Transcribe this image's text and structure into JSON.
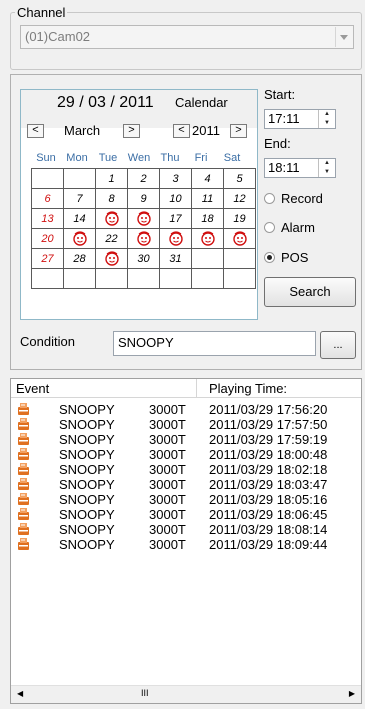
{
  "channel": {
    "legend": "Channel",
    "selected": "(01)Cam02"
  },
  "calendar": {
    "date": "29 / 03 / 2011",
    "title": "Calendar",
    "month_prev": "<",
    "month": "March",
    "month_next": ">",
    "year_prev": "<",
    "year": "2011",
    "year_next": ">",
    "weekdays": [
      "Sun",
      "Mon",
      "Tue",
      "Wen",
      "Thu",
      "Fri",
      "Sat"
    ],
    "weeks": [
      [
        "",
        "",
        "1",
        "2",
        "3",
        "4",
        "5"
      ],
      [
        "6",
        "7",
        "8",
        "9",
        "10",
        "11",
        "12"
      ],
      [
        "13",
        "14",
        "15",
        "16",
        "17",
        "18",
        "19"
      ],
      [
        "20",
        "21",
        "22",
        "23",
        "24",
        "25",
        "26"
      ],
      [
        "27",
        "28",
        "29",
        "30",
        "31",
        "",
        ""
      ],
      [
        "",
        "",
        "",
        "",
        "",
        "",
        ""
      ]
    ],
    "face_days": [
      "15",
      "16",
      "21",
      "23",
      "24",
      "25",
      "26",
      "29"
    ],
    "red_days": [
      "6",
      "13",
      "20",
      "27"
    ]
  },
  "time": {
    "start_label": "Start:",
    "start_value": "17:11",
    "end_label": "End:",
    "end_value": "18:11"
  },
  "filters": {
    "options": [
      "Record",
      "Alarm",
      "POS"
    ],
    "selected": "POS"
  },
  "search_label": "Search",
  "condition": {
    "label": "Condition",
    "value": "SNOOPY",
    "browse_label": "..."
  },
  "events": {
    "columns": [
      "Event",
      "Playing Time:"
    ],
    "rows": [
      {
        "name": "SNOOPY",
        "code": "3000T",
        "time": "2011/03/29 17:56:20"
      },
      {
        "name": "SNOOPY",
        "code": "3000T",
        "time": "2011/03/29 17:57:50"
      },
      {
        "name": "SNOOPY",
        "code": "3000T",
        "time": "2011/03/29 17:59:19"
      },
      {
        "name": "SNOOPY",
        "code": "3000T",
        "time": "2011/03/29 18:00:48"
      },
      {
        "name": "SNOOPY",
        "code": "3000T",
        "time": "2011/03/29 18:02:18"
      },
      {
        "name": "SNOOPY",
        "code": "3000T",
        "time": "2011/03/29 18:03:47"
      },
      {
        "name": "SNOOPY",
        "code": "3000T",
        "time": "2011/03/29 18:05:16"
      },
      {
        "name": "SNOOPY",
        "code": "3000T",
        "time": "2011/03/29 18:06:45"
      },
      {
        "name": "SNOOPY",
        "code": "3000T",
        "time": "2011/03/29 18:08:14"
      },
      {
        "name": "SNOOPY",
        "code": "3000T",
        "time": "2011/03/29 18:09:44"
      }
    ],
    "scroll_thumb": "III"
  },
  "colors": {
    "red_day": "#d01010",
    "face": "#d01010",
    "weekday": "#3b6ea5",
    "event_icon": "#e07020"
  }
}
